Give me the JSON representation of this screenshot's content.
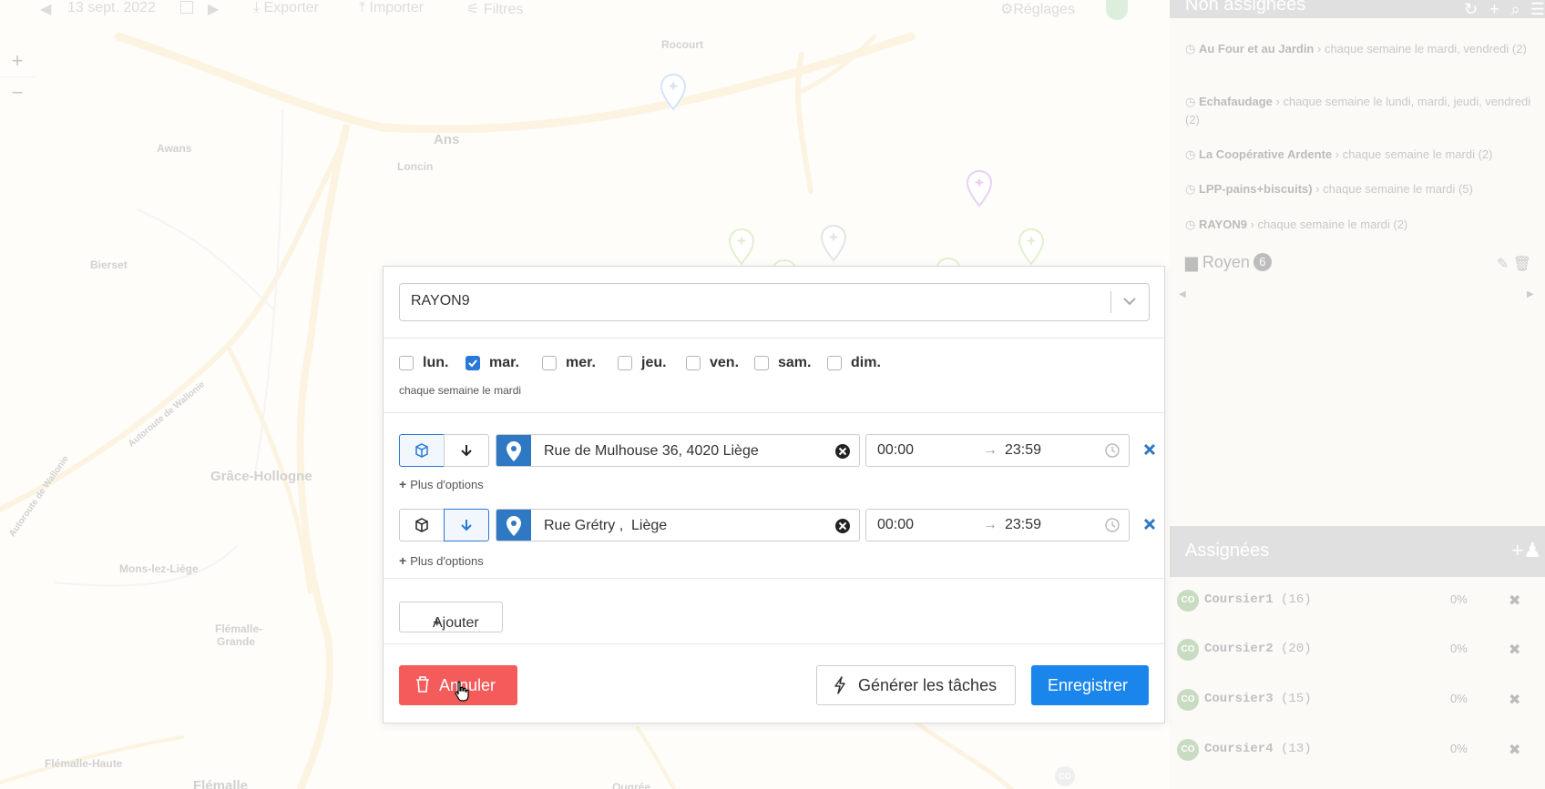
{
  "topbar": {
    "date": "13 sept. 2022",
    "export_label": "Exporter",
    "import_label": "Importer",
    "filters_label": "Filtres",
    "settings_label": "Réglages"
  },
  "map": {
    "places": {
      "rocourt": "Rocourt",
      "ans": "Ans",
      "awans": "Awans",
      "loncin": "Loncin",
      "bierset": "Bierset",
      "grace_hollogne": "Grâce-Hollogne",
      "mons_lez_liege": "Mons-lez-Liège",
      "flemalle_grande_1": "Flémalle-",
      "flemalle_grande_2": "Grande",
      "flemalle_haute": "Flémalle-Haute",
      "flemalle": "Flémalle",
      "ougree": "Ougrée",
      "autoroute_1": "Autoroute de Wallonie",
      "autoroute_2": "Autoroute de Wallonie"
    },
    "marker_label": "CO"
  },
  "unassigned": {
    "title": "Non assignées",
    "tasks": [
      {
        "name": "Au Four et au Jardin",
        "detail": "› chaque semaine le mardi, vendredi (2)"
      },
      {
        "name": "Echafaudage",
        "detail": "› chaque semaine le lundi, mardi, jeudi, vendredi (2)"
      },
      {
        "name": "La Coopérative Ardente",
        "detail": "› chaque semaine le mardi (2)"
      },
      {
        "name": "LPP-pains+biscuits)",
        "detail": "› chaque semaine le mardi (5)"
      },
      {
        "name": "RAYON9",
        "detail": "› chaque semaine le mardi (2)"
      }
    ],
    "folder": {
      "name": "Royen",
      "count": "6"
    }
  },
  "assigned": {
    "title": "Assignées",
    "couriers": [
      {
        "initials": "CO",
        "name": "Coursier1",
        "count": "(16)",
        "progress": "0%"
      },
      {
        "initials": "CO",
        "name": "Coursier2",
        "count": "(20)",
        "progress": "0%"
      },
      {
        "initials": "CO",
        "name": "Coursier3",
        "count": "(15)",
        "progress": "0%"
      },
      {
        "initials": "CO",
        "name": "Coursier4",
        "count": "(13)",
        "progress": "0%"
      }
    ]
  },
  "modal": {
    "store_select": "RAYON9",
    "days": [
      {
        "label": "lun.",
        "checked": false
      },
      {
        "label": "mar.",
        "checked": true
      },
      {
        "label": "mer.",
        "checked": false
      },
      {
        "label": "jeu.",
        "checked": false
      },
      {
        "label": "ven.",
        "checked": false
      },
      {
        "label": "sam.",
        "checked": false
      },
      {
        "label": "dim.",
        "checked": false
      }
    ],
    "recurrence_text": "chaque semaine le mardi",
    "tasks": [
      {
        "type": "pickup",
        "address": "Rue de Mulhouse 36, 4020 Liège",
        "time_from": "00:00",
        "time_to": "23:59",
        "more_options": "Plus d'options"
      },
      {
        "type": "dropoff",
        "address": "Rue Grétry ,  Liège",
        "time_from": "00:00",
        "time_to": "23:59",
        "more_options": "Plus d'options"
      }
    ],
    "add_label": "Ajouter",
    "cancel_label": "Annuler",
    "generate_label": "Générer les tâches",
    "save_label": "Enregistrer"
  },
  "colors": {
    "primary": "#1a86ec",
    "danger": "#f45b5b",
    "pin_blue": "#2f78c4"
  }
}
